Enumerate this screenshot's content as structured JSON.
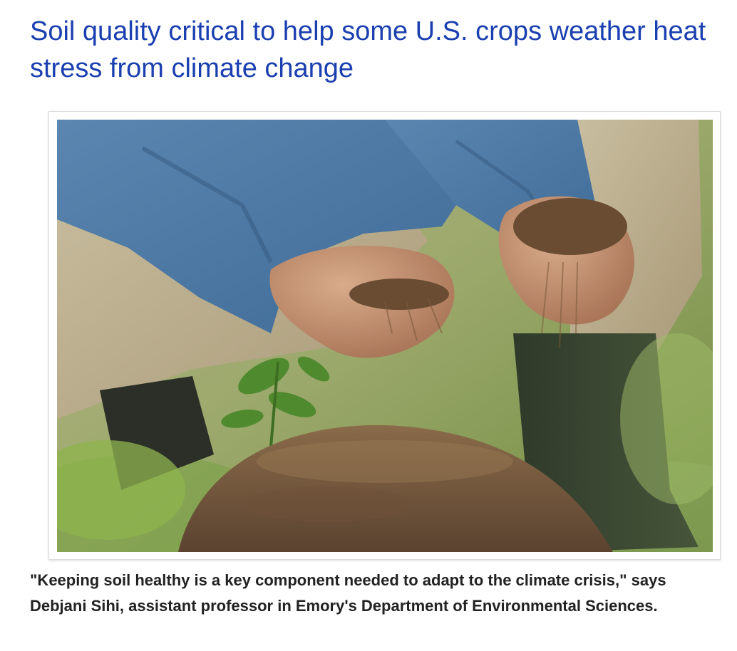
{
  "article": {
    "headline": "Soil quality critical to help some U.S. crops weather heat stress from climate change",
    "caption": "\"Keeping soil healthy is a key component needed to adapt to the climate crisis,\" says Debjani Sihi, assistant professor in Emory's Department of Environmental Sciences."
  },
  "colors": {
    "headline": "#1a3fb0",
    "caption": "#222222",
    "frame_border": "#dcdcdc"
  },
  "photo": {
    "subject": "hands-holding-soil-photo"
  }
}
